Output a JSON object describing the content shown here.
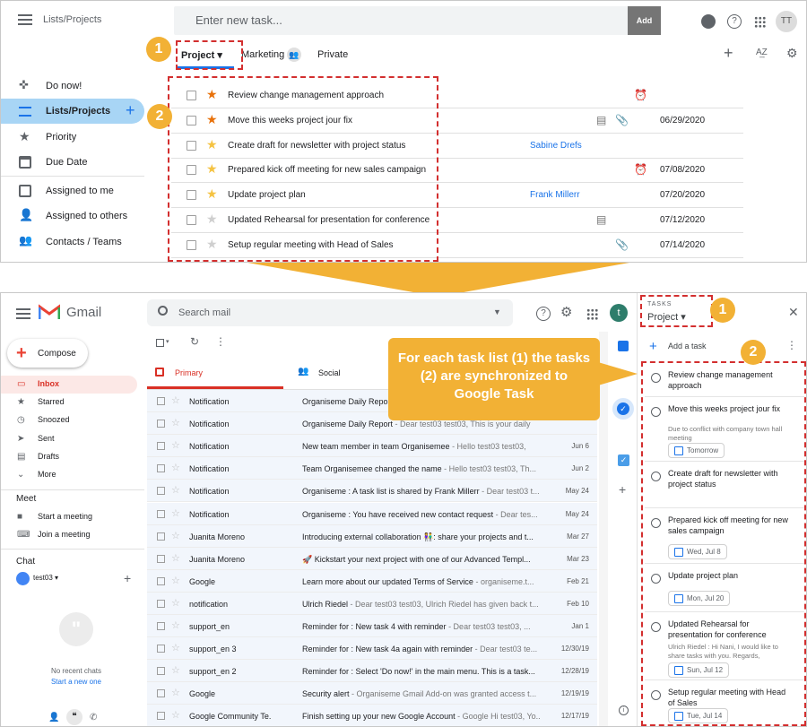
{
  "top": {
    "app_title": "Lists/Projects",
    "task_input_placeholder": "Enter new task...",
    "add_label": "Add",
    "avatar": "TT",
    "tabs": [
      {
        "label": "Project"
      },
      {
        "label": "Marketing"
      },
      {
        "label": "Private"
      }
    ],
    "sidebar": [
      {
        "label": "Do now!",
        "icon": "gamepad-icon"
      },
      {
        "label": "Lists/Projects",
        "icon": "list-icon"
      },
      {
        "label": "Priority",
        "icon": "star-icon"
      },
      {
        "label": "Due Date",
        "icon": "calendar-icon"
      },
      {
        "label": "Assigned to me",
        "icon": "inbox-icon"
      },
      {
        "label": "Assigned to others",
        "icon": "person-icon"
      },
      {
        "label": "Contacts / Teams",
        "icon": "people-icon"
      }
    ],
    "tasks": [
      {
        "title": "Review change management approach",
        "star_color": "#e8710a",
        "assignee": "",
        "date": "",
        "icons": [
          "alarm-icon"
        ]
      },
      {
        "title": "Move this weeks project jour fix",
        "star_color": "#e8710a",
        "assignee": "",
        "date": "06/29/2020",
        "icons": [
          "note-icon",
          "attachment-icon"
        ]
      },
      {
        "title": "Create draft for newsletter with project status",
        "star_color": "#f5c342",
        "assignee": "Sabine Drefs",
        "date": "",
        "icons": []
      },
      {
        "title": "Prepared kick off meeting for new sales campaign",
        "star_color": "#f5c342",
        "assignee": "",
        "date": "07/08/2020",
        "icons": [
          "alarm-icon"
        ]
      },
      {
        "title": "Update project plan",
        "star_color": "#f5c342",
        "assignee": "Frank Millerr",
        "date": "07/20/2020",
        "icons": []
      },
      {
        "title": "Updated Rehearsal for presentation for conference",
        "star_color": "#cfcfcf",
        "assignee": "",
        "date": "07/12/2020",
        "icons": [
          "note-icon"
        ]
      },
      {
        "title": "Setup regular meeting with Head of Sales",
        "star_color": "#cfcfcf",
        "assignee": "",
        "date": "07/14/2020",
        "icons": [
          "attachment-icon"
        ]
      }
    ]
  },
  "badges": {
    "one": "1",
    "two": "2"
  },
  "callout": "For each task list (1) the tasks (2) are synchronized to Google Task",
  "gmail": {
    "brand": "Gmail",
    "search_placeholder": "Search mail",
    "avatar": "t",
    "compose": "Compose",
    "nav": [
      {
        "label": "Inbox",
        "icon": "inbox-icon"
      },
      {
        "label": "Starred",
        "icon": "star-icon"
      },
      {
        "label": "Snoozed",
        "icon": "clock-icon"
      },
      {
        "label": "Sent",
        "icon": "send-icon"
      },
      {
        "label": "Drafts",
        "icon": "file-icon"
      },
      {
        "label": "More",
        "icon": "chevron-down-icon"
      }
    ],
    "meet_heading": "Meet",
    "meet": [
      {
        "label": "Start a meeting",
        "icon": "video-icon"
      },
      {
        "label": "Join a meeting",
        "icon": "keyboard-icon"
      }
    ],
    "chat_heading": "Chat",
    "chat_user": "test03",
    "no_chats": "No recent chats",
    "start_chat": "Start a new one",
    "tab_primary": "Primary",
    "tab_social": "Social",
    "emails": [
      {
        "sender": "Notification",
        "subject": "Organiseme Daily Report",
        "preview": "",
        "date": ""
      },
      {
        "sender": "Notification",
        "subject": "Organiseme Daily Report",
        "preview": " - Dear test03 test03, This is your daily",
        "date": ""
      },
      {
        "sender": "Notification",
        "subject": "New team member in team Organisemee",
        "preview": " - Hello test03 test03,",
        "date": "Jun 6"
      },
      {
        "sender": "Notification",
        "subject": "Team Organisemee changed the name",
        "preview": " - Hello test03 test03, Th...",
        "date": "Jun 2"
      },
      {
        "sender": "Notification",
        "subject": "Organiseme : A task list is shared by Frank Millerr",
        "preview": " - Dear test03 t...",
        "date": "May 24"
      },
      {
        "sender": "Notification",
        "subject": "Organiseme : You have received new contact request",
        "preview": " - Dear tes...",
        "date": "May 24"
      },
      {
        "sender": "Juanita Moreno",
        "subject": "Introducing external collaboration 👫: share your projects and t...",
        "preview": "",
        "date": "Mar 27"
      },
      {
        "sender": "Juanita Moreno",
        "subject": "🚀 Kickstart your next project with one of our Advanced Templ...",
        "preview": "",
        "date": "Mar 23"
      },
      {
        "sender": "Google",
        "subject": "Learn more about our updated Terms of Service",
        "preview": " - organiseme.t...",
        "date": "Feb 21"
      },
      {
        "sender": "notification",
        "subject": "Ulrich Riedel",
        "preview": " - Dear test03 test03, Ulrich Riedel has given back t...",
        "date": "Feb 10"
      },
      {
        "sender": "support_en",
        "subject": "Reminder for : New task 4 with reminder",
        "preview": " - Dear test03 test03, ...",
        "date": "Jan 1"
      },
      {
        "sender": "support_en 3",
        "subject": "Reminder for : New task 4a again with reminder",
        "preview": " - Dear test03 te...",
        "date": "12/30/19"
      },
      {
        "sender": "support_en 2",
        "subject": "Reminder for : Select 'Do now!' in the main menu. This is a task...",
        "preview": "",
        "date": "12/28/19"
      },
      {
        "sender": "Google",
        "subject": "Security alert",
        "preview": " - Organiseme Gmail Add-on was granted access t...",
        "date": "12/19/19"
      },
      {
        "sender": "Google Community Te.",
        "subject": "Finish setting up your new Google Account",
        "preview": " - Google Hi test03, Yo...",
        "date": "12/17/19"
      }
    ],
    "tasks_panel": {
      "header": "TASKS",
      "list_name": "Project",
      "add_task": "Add a task",
      "items": [
        {
          "title": "Review change management approach",
          "notes": "",
          "due": ""
        },
        {
          "title": "Move this weeks project jour fix",
          "notes": "Due to conflict with company town hall meeting",
          "due": "Tomorrow"
        },
        {
          "title": "Create draft for newsletter with project status",
          "notes": "",
          "due": ""
        },
        {
          "title": "Prepared kick off meeting for new sales campaign",
          "notes": "",
          "due": "Wed, Jul 8"
        },
        {
          "title": "Update project plan",
          "notes": "",
          "due": "Mon, Jul 20"
        },
        {
          "title": "Updated Rehearsal for presentation for conference",
          "notes": "Ulrich Riedel : Hi Nani, I would like to share tasks with you. Regards,",
          "due": "Sun, Jul 12"
        },
        {
          "title": "Setup regular meeting with Head of Sales",
          "notes": "",
          "due": "Tue, Jul 14"
        }
      ]
    }
  }
}
